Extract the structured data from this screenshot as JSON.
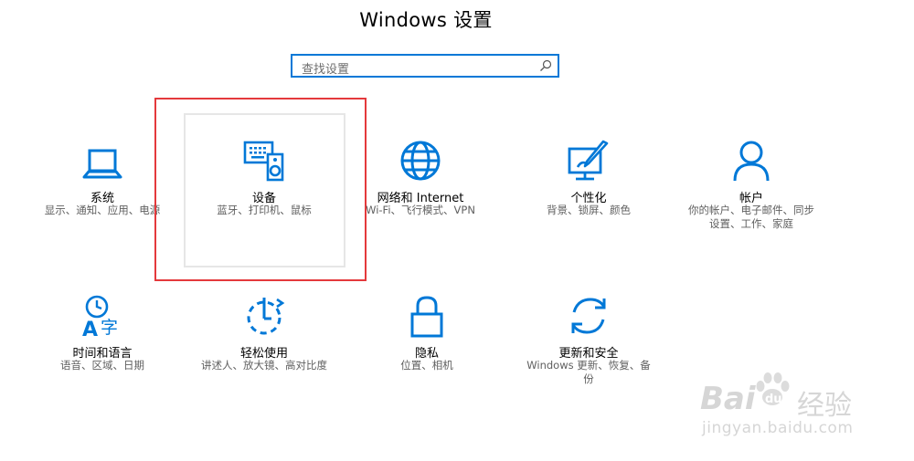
{
  "window": {
    "title": "Windows 设置"
  },
  "search": {
    "placeholder": "查找设置"
  },
  "tiles": [
    {
      "name": "系统",
      "desc": "显示、通知、应用、电源",
      "icon": "laptop-icon"
    },
    {
      "name": "设备",
      "desc": "蓝牙、打印机、鼠标",
      "icon": "devices-icon"
    },
    {
      "name": "网络和 Internet",
      "desc": "Wi-Fi、飞行模式、VPN",
      "icon": "globe-icon"
    },
    {
      "name": "个性化",
      "desc": "背景、锁屏、颜色",
      "icon": "personalization-icon"
    },
    {
      "name": "帐户",
      "desc": "你的帐户、电子邮件、同步设置、工作、家庭",
      "desc_line1": "你的帐户、电子邮件、同步",
      "desc_line2": "设置、工作、家庭",
      "icon": "person-icon"
    },
    {
      "name": "时间和语言",
      "desc": "语音、区域、日期",
      "icon": "time-language-icon"
    },
    {
      "name": "轻松使用",
      "desc": "讲述人、放大镜、高对比度",
      "icon": "ease-of-access-icon"
    },
    {
      "name": "隐私",
      "desc": "位置、相机",
      "icon": "lock-icon"
    },
    {
      "name": "更新和安全",
      "desc": "Windows 更新、恢复、备份",
      "desc_line1": "Windows 更新、恢复、备",
      "desc_line2": "份",
      "icon": "sync-icon"
    }
  ],
  "watermark": {
    "brand": "Bai",
    "brand2": "du",
    "cn": "经验",
    "url": "jingyan.baidu.com"
  },
  "colors": {
    "accent": "#0078d7",
    "highlight": "#e4393c"
  }
}
